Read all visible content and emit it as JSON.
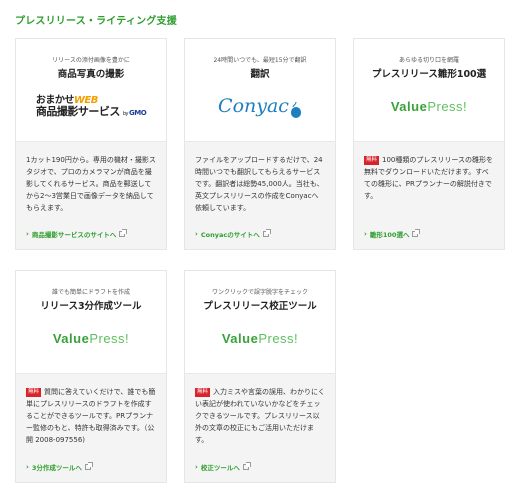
{
  "section_title": "プレスリリース・ライティング支援",
  "cards": [
    {
      "sub": "リリースの添付画像を豊かに",
      "head": "商品写真の撮影",
      "logo": {
        "type": "gmo",
        "line1_a": "おまかせ",
        "line1_b": "WEB",
        "line2": "商品撮影サービス",
        "by": "by",
        "gmo": "GMO"
      },
      "badge": "",
      "desc": "1カット190円から。専用の機材・撮影スタジオで、プロのカメラマンが商品を撮影してくれるサービス。商品を郵送してから2～3営業日で画像データを納品してもらえます。",
      "link": "商品撮影サービスのサイトへ"
    },
    {
      "sub": "24時間いつでも、最短15分で翻訳",
      "head": "翻訳",
      "logo": {
        "type": "conyac",
        "text": "Conyac"
      },
      "badge": "",
      "desc": "ファイルをアップロードするだけで、24時間いつでも翻訳してもらえるサービスです。翻訳者は総勢45,000人。当社も、英文プレスリリースの作成をConyacへ依頼しています。",
      "link": "Conyacのサイトへ"
    },
    {
      "sub": "あらゆる切り口を網羅",
      "head": "プレスリリース雛形100選",
      "logo": {
        "type": "valuepress",
        "part1": "Value",
        "part2": "Press!"
      },
      "badge": "無料",
      "desc": "100種類のプレスリリースの雛形を無料でダウンロードいただけます。すべての雛形に、PRプランナーの解説付きです。",
      "link": "雛形100選へ"
    },
    {
      "sub": "誰でも簡単にドラフトを作成",
      "head": "リリース3分作成ツール",
      "logo": {
        "type": "valuepress",
        "part1": "Value",
        "part2": "Press!"
      },
      "badge": "無料",
      "desc": "質問に答えていくだけで、誰でも簡単にプレスリリースのドラフトを作成することができるツールです。PRプランナー監修のもと、特許も取得済みです。（公開 2008-097556)",
      "link": "3分作成ツールへ"
    },
    {
      "sub": "ワンクリックで誤字脱字をチェック",
      "head": "プレスリリース校正ツール",
      "logo": {
        "type": "valuepress",
        "part1": "Value",
        "part2": "Press!"
      },
      "badge": "無料",
      "desc": "入力ミスや言葉の誤用、わかりにくい表記が使われていないかなどをチェックできるツールです。プレスリリース以外の文章の校正にもご活用いただけます。",
      "link": "校正ツールへ"
    }
  ],
  "colors": {
    "accent": "#2e9e2e",
    "badge": "#d9232a",
    "conyac": "#1e7fc0"
  },
  "icons": {
    "link_arrow": "chevron-right-icon",
    "external": "external-link-icon"
  }
}
